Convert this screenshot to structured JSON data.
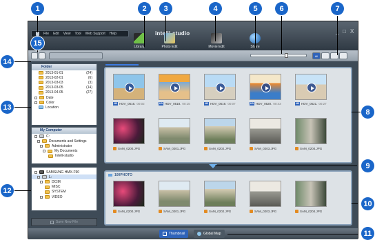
{
  "app": {
    "logo": "intelli-studio",
    "menu": [
      "File",
      "Edit",
      "View",
      "Tool",
      "Web Support",
      "Help"
    ],
    "window_controls": [
      "_",
      "□",
      "X"
    ]
  },
  "modes": [
    {
      "label": "Library",
      "icon": "library-icon"
    },
    {
      "label": "Photo Edit",
      "icon": "photo-edit-icon"
    },
    {
      "label": "Movie Edit",
      "icon": "movie-edit-icon"
    },
    {
      "label": "Share",
      "icon": "share-icon"
    }
  ],
  "view_filter": [
    "All",
    "Photo",
    "Video",
    "Audio"
  ],
  "library_tree": {
    "header": "Folder",
    "folders": [
      {
        "name": "2013-01-01",
        "count": "(24)"
      },
      {
        "name": "2013-02-01",
        "count": "(6)"
      },
      {
        "name": "2013-03-03",
        "count": "(3)"
      },
      {
        "name": "2013-03-05",
        "count": "(14)"
      },
      {
        "name": "2013-04-05",
        "count": "(27)"
      }
    ],
    "groups": [
      "Date",
      "Color",
      "Location"
    ]
  },
  "computer_tree": {
    "header": "My Computer",
    "items": [
      "C:",
      "Documents and Settings",
      "Administrator",
      "My Documents",
      "Intelli-studio"
    ]
  },
  "device_tree": {
    "device": "SAMSUNG HMX-F90",
    "drive": "L:",
    "folders": [
      "DCIM",
      "MISC",
      "SYSTEM",
      "VIDEO"
    ]
  },
  "save_button": "Save New File",
  "library_items": [
    {
      "type": "video",
      "name": "HDV_0516.",
      "dur": "00:02"
    },
    {
      "type": "video",
      "name": "HDV_0518.",
      "dur": "00:15"
    },
    {
      "type": "video",
      "name": "HDV_0519.",
      "dur": "00:07"
    },
    {
      "type": "video",
      "name": "HDV_0520.",
      "dur": "00:43"
    },
    {
      "type": "video",
      "name": "HDV_0521.",
      "dur": "00:27"
    },
    {
      "type": "photo",
      "name": "SAM_0200.JPG"
    },
    {
      "type": "photo",
      "name": "SAM_0201.JPG"
    },
    {
      "type": "photo",
      "name": "SAM_0202.JPG"
    },
    {
      "type": "photo",
      "name": "SAM_0203.JPG"
    },
    {
      "type": "photo",
      "name": "SAM_0204.JPG"
    }
  ],
  "device_panel": {
    "folder": "100PHOTO",
    "items": [
      "SAM_0200.JPG",
      "SAM_0201.JPG",
      "SAM_0202.JPG",
      "SAM_0203.JPG",
      "SAM_0204.JPG"
    ]
  },
  "view_tabs": [
    {
      "label": "Thumbnail",
      "active": true
    },
    {
      "label": "Global Map",
      "active": false
    }
  ],
  "zoom_level": 0.65,
  "callouts": [
    "1",
    "2",
    "3",
    "4",
    "5",
    "6",
    "7",
    "8",
    "9",
    "10",
    "11",
    "12",
    "13",
    "14",
    "15"
  ],
  "colors": {
    "callout": "#1a66c9",
    "window": "#3e4b57",
    "accent": "#3d7ae0"
  }
}
